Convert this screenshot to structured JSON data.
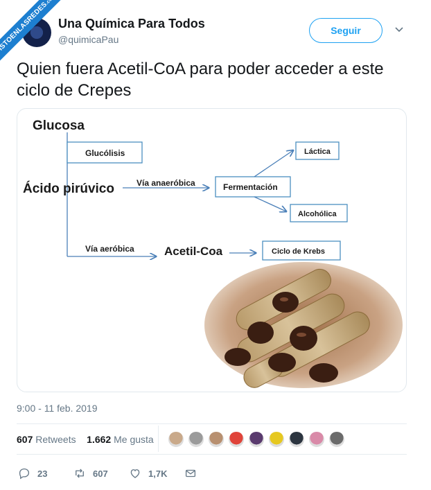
{
  "watermark": {
    "text": "VISTOENLASREDES",
    "suffix": ".com"
  },
  "account": {
    "name": "Una Química Para Todos",
    "handle": "@quimicaPau",
    "follow_label": "Seguir"
  },
  "tweet": {
    "text": "Quien fuera Acetil-CoA para poder acceder a este ciclo de Crepes"
  },
  "diagram": {
    "glucosa": "Glucosa",
    "glucolisis": "Glucólisis",
    "acido_piruvico": "Ácido pirúvico",
    "via_anaerobica": "Vía anaeróbica",
    "fermentacion": "Fermentación",
    "lactica": "Láctica",
    "alcoholica": "Alcohólica",
    "via_aerobica": "Vía aeróbica",
    "acetil_coa": "Acetil-Coa",
    "ciclo_krebs": "Ciclo de Krebs"
  },
  "meta": {
    "timestamp": "9:00 - 11 feb. 2019"
  },
  "stats": {
    "retweets_count": "607",
    "retweets_label": "Retweets",
    "likes_count": "1.662",
    "likes_label": "Me gusta"
  },
  "likers": [
    "#c9a98a",
    "#9b9b9b",
    "#b89070",
    "#e0443a",
    "#5a3b6e",
    "#e6c820",
    "#2c3540",
    "#d98aa8",
    "#6b6b6b"
  ],
  "actions": {
    "replies": "23",
    "retweets": "607",
    "likes": "1,7K"
  },
  "colors": {
    "accent": "#1da1f2",
    "arrow": "#4a7fb8",
    "box_border": "#4a8fc0",
    "muted": "#657786"
  }
}
